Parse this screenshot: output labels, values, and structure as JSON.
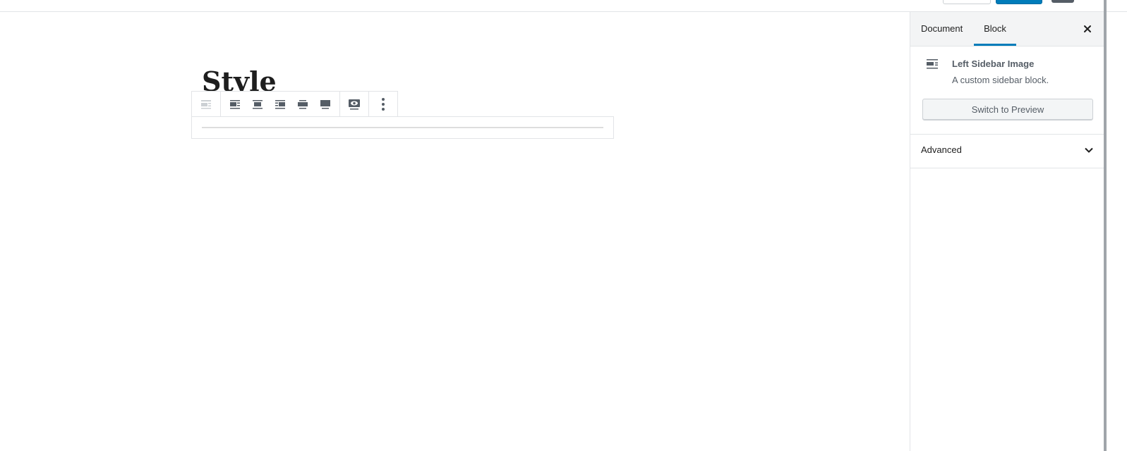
{
  "editor": {
    "title": "Style"
  },
  "block_toolbar": {
    "groups": [
      [
        "block-type-icon"
      ],
      [
        "align-left-icon",
        "align-center-icon",
        "align-right-icon",
        "align-wide-icon",
        "align-full-icon"
      ],
      [
        "preview-eye-icon"
      ],
      [
        "more-options-icon"
      ]
    ]
  },
  "sidebar": {
    "tabs": [
      {
        "label": "Document",
        "active": false
      },
      {
        "label": "Block",
        "active": true
      }
    ],
    "close_icon": "close-icon",
    "block_card": {
      "icon": "left-sidebar-block-icon",
      "title": "Left Sidebar Image",
      "description": "A custom sidebar block.",
      "switch_button": "Switch to Preview"
    },
    "advanced": {
      "label": "Advanced",
      "icon": "chevron-down-icon",
      "expanded": false
    }
  },
  "colors": {
    "accent": "#007cba",
    "border": "#e2e4e7",
    "icon": "#555d66"
  }
}
